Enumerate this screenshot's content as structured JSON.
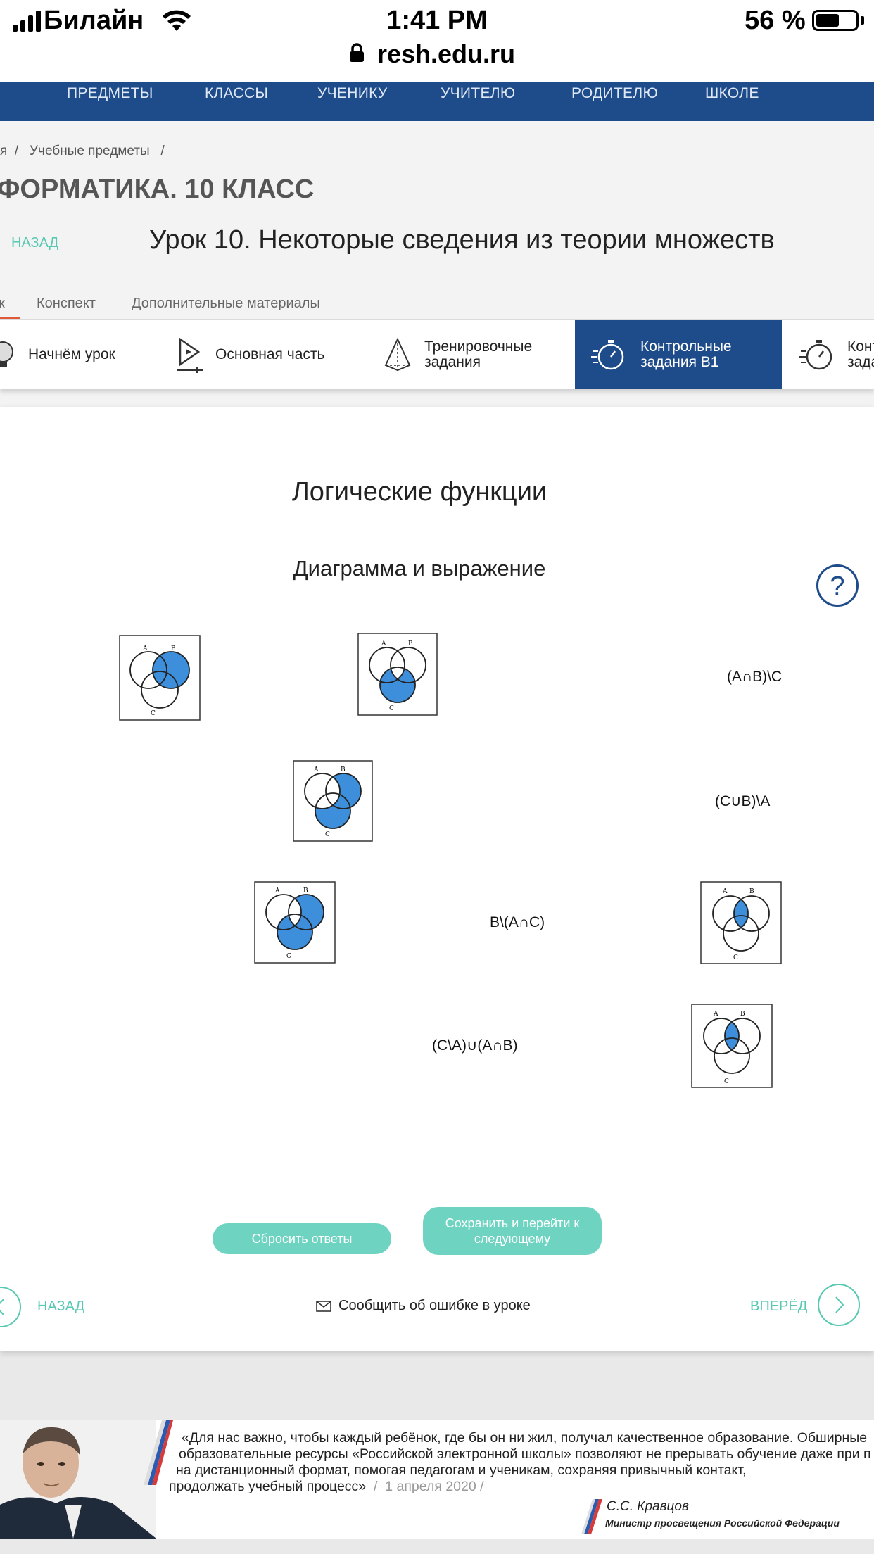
{
  "status_bar": {
    "carrier": "Билайн",
    "time": "1:41 PM",
    "battery": "56 %",
    "url": "resh.edu.ru"
  },
  "nav": [
    "ПРЕДМЕТЫ",
    "КЛАССЫ",
    "УЧЕНИКУ",
    "УЧИТЕЛЮ",
    "РОДИТЕЛЮ",
    "ШКОЛЕ"
  ],
  "breadcrumbs": {
    "first": "я",
    "second": "Учебные предметы"
  },
  "course_title": "ФОРМАТИКА. 10 КЛАСС",
  "back_top": "НАЗАД",
  "lesson_title": "Урок 10. Некоторые сведения из теории множеств",
  "tabs": {
    "t0": "к",
    "t1": "Конспект",
    "t2": "Дополнительные материалы"
  },
  "steps": {
    "s1": "Начнём урок",
    "s2": "Основная часть",
    "s3a": "Тренировочные",
    "s3b": "задания",
    "s4a": "Контрольные",
    "s4b": "задания B1",
    "s5a": "Конт",
    "s5b": "зада"
  },
  "task": {
    "title": "Логические функции",
    "subtitle": "Диаграмма и выражение"
  },
  "help": "?",
  "venn_letters": {
    "a": "A",
    "b": "B",
    "c": "C"
  },
  "expressions": [
    "(A∩B)\\C",
    "(C∪B)\\A",
    "B\\(A∩C)",
    "(C\\A)∪(A∩B)"
  ],
  "buttons": {
    "reset": "Сбросить ответы",
    "save_a": "Сохранить и перейти к",
    "save_b": "следующему"
  },
  "footer_nav": {
    "back": "НАЗАД",
    "forward": "ВПЕРЁД",
    "report": "Сообщить об ошибке в уроке"
  },
  "quote": {
    "l1": "«Для нас важно, чтобы каждый ребёнок, где бы он ни жил, получал качественное образование. Обширные",
    "l2": "образовательные ресурсы «Российской электронной школы» позволяют не прерывать обучение даже при п",
    "l3": "на дистанционный формат, помогая педагогам и ученикам, сохраняя привычный контакт,",
    "l4": "продолжать учебный процесс»",
    "date": "1 апреля 2020",
    "author": "С.С. Кравцов",
    "author_title": "Министр просвещения Российской Федерации"
  },
  "colors": {
    "nav": "#1e4b8a",
    "accent": "#57c8b2",
    "venn_fill": "#3d8fdc",
    "button": "#6ed4c1"
  }
}
